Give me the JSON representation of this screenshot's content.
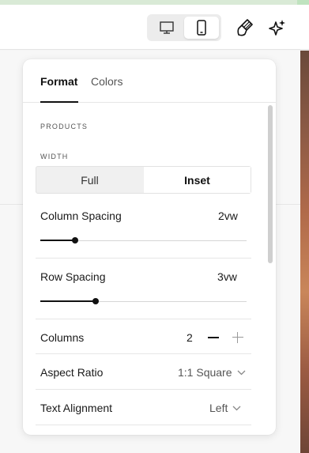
{
  "toolbar": {
    "device_toggle": {
      "options": [
        "desktop-icon",
        "mobile-icon"
      ],
      "selected": "mobile-icon"
    },
    "tools": [
      "brush-icon",
      "sparkle-icon"
    ]
  },
  "panel": {
    "tabs": [
      {
        "label": "Format",
        "active": true
      },
      {
        "label": "Colors",
        "active": false
      }
    ],
    "section_title": "PRODUCTS",
    "width": {
      "label": "WIDTH",
      "options": [
        "Full",
        "Inset"
      ],
      "selected": "Inset"
    },
    "column_spacing": {
      "label": "Column Spacing",
      "value": "2vw",
      "level": 0.17
    },
    "row_spacing": {
      "label": "Row Spacing",
      "value": "3vw",
      "level": 0.27
    },
    "columns": {
      "label": "Columns",
      "value": "2"
    },
    "aspect_ratio": {
      "label": "Aspect Ratio",
      "value": "1:1 Square"
    },
    "text_alignment": {
      "label": "Text Alignment",
      "value": "Left"
    }
  },
  "colors": {
    "accent": "#111111",
    "muted": "#999999",
    "track": "#d6d6d6"
  }
}
